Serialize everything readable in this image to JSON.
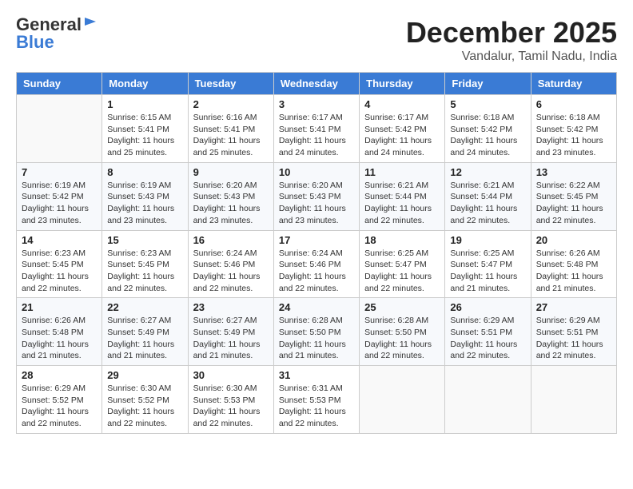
{
  "logo": {
    "general": "General",
    "blue": "Blue"
  },
  "title": {
    "month_year": "December 2025",
    "location": "Vandalur, Tamil Nadu, India"
  },
  "calendar": {
    "headers": [
      "Sunday",
      "Monday",
      "Tuesday",
      "Wednesday",
      "Thursday",
      "Friday",
      "Saturday"
    ],
    "weeks": [
      [
        {
          "day": "",
          "info": ""
        },
        {
          "day": "1",
          "info": "Sunrise: 6:15 AM\nSunset: 5:41 PM\nDaylight: 11 hours\nand 25 minutes."
        },
        {
          "day": "2",
          "info": "Sunrise: 6:16 AM\nSunset: 5:41 PM\nDaylight: 11 hours\nand 25 minutes."
        },
        {
          "day": "3",
          "info": "Sunrise: 6:17 AM\nSunset: 5:41 PM\nDaylight: 11 hours\nand 24 minutes."
        },
        {
          "day": "4",
          "info": "Sunrise: 6:17 AM\nSunset: 5:42 PM\nDaylight: 11 hours\nand 24 minutes."
        },
        {
          "day": "5",
          "info": "Sunrise: 6:18 AM\nSunset: 5:42 PM\nDaylight: 11 hours\nand 24 minutes."
        },
        {
          "day": "6",
          "info": "Sunrise: 6:18 AM\nSunset: 5:42 PM\nDaylight: 11 hours\nand 23 minutes."
        }
      ],
      [
        {
          "day": "7",
          "info": "Sunrise: 6:19 AM\nSunset: 5:42 PM\nDaylight: 11 hours\nand 23 minutes."
        },
        {
          "day": "8",
          "info": "Sunrise: 6:19 AM\nSunset: 5:43 PM\nDaylight: 11 hours\nand 23 minutes."
        },
        {
          "day": "9",
          "info": "Sunrise: 6:20 AM\nSunset: 5:43 PM\nDaylight: 11 hours\nand 23 minutes."
        },
        {
          "day": "10",
          "info": "Sunrise: 6:20 AM\nSunset: 5:43 PM\nDaylight: 11 hours\nand 23 minutes."
        },
        {
          "day": "11",
          "info": "Sunrise: 6:21 AM\nSunset: 5:44 PM\nDaylight: 11 hours\nand 22 minutes."
        },
        {
          "day": "12",
          "info": "Sunrise: 6:21 AM\nSunset: 5:44 PM\nDaylight: 11 hours\nand 22 minutes."
        },
        {
          "day": "13",
          "info": "Sunrise: 6:22 AM\nSunset: 5:45 PM\nDaylight: 11 hours\nand 22 minutes."
        }
      ],
      [
        {
          "day": "14",
          "info": "Sunrise: 6:23 AM\nSunset: 5:45 PM\nDaylight: 11 hours\nand 22 minutes."
        },
        {
          "day": "15",
          "info": "Sunrise: 6:23 AM\nSunset: 5:45 PM\nDaylight: 11 hours\nand 22 minutes."
        },
        {
          "day": "16",
          "info": "Sunrise: 6:24 AM\nSunset: 5:46 PM\nDaylight: 11 hours\nand 22 minutes."
        },
        {
          "day": "17",
          "info": "Sunrise: 6:24 AM\nSunset: 5:46 PM\nDaylight: 11 hours\nand 22 minutes."
        },
        {
          "day": "18",
          "info": "Sunrise: 6:25 AM\nSunset: 5:47 PM\nDaylight: 11 hours\nand 22 minutes."
        },
        {
          "day": "19",
          "info": "Sunrise: 6:25 AM\nSunset: 5:47 PM\nDaylight: 11 hours\nand 21 minutes."
        },
        {
          "day": "20",
          "info": "Sunrise: 6:26 AM\nSunset: 5:48 PM\nDaylight: 11 hours\nand 21 minutes."
        }
      ],
      [
        {
          "day": "21",
          "info": "Sunrise: 6:26 AM\nSunset: 5:48 PM\nDaylight: 11 hours\nand 21 minutes."
        },
        {
          "day": "22",
          "info": "Sunrise: 6:27 AM\nSunset: 5:49 PM\nDaylight: 11 hours\nand 21 minutes."
        },
        {
          "day": "23",
          "info": "Sunrise: 6:27 AM\nSunset: 5:49 PM\nDaylight: 11 hours\nand 21 minutes."
        },
        {
          "day": "24",
          "info": "Sunrise: 6:28 AM\nSunset: 5:50 PM\nDaylight: 11 hours\nand 21 minutes."
        },
        {
          "day": "25",
          "info": "Sunrise: 6:28 AM\nSunset: 5:50 PM\nDaylight: 11 hours\nand 22 minutes."
        },
        {
          "day": "26",
          "info": "Sunrise: 6:29 AM\nSunset: 5:51 PM\nDaylight: 11 hours\nand 22 minutes."
        },
        {
          "day": "27",
          "info": "Sunrise: 6:29 AM\nSunset: 5:51 PM\nDaylight: 11 hours\nand 22 minutes."
        }
      ],
      [
        {
          "day": "28",
          "info": "Sunrise: 6:29 AM\nSunset: 5:52 PM\nDaylight: 11 hours\nand 22 minutes."
        },
        {
          "day": "29",
          "info": "Sunrise: 6:30 AM\nSunset: 5:52 PM\nDaylight: 11 hours\nand 22 minutes."
        },
        {
          "day": "30",
          "info": "Sunrise: 6:30 AM\nSunset: 5:53 PM\nDaylight: 11 hours\nand 22 minutes."
        },
        {
          "day": "31",
          "info": "Sunrise: 6:31 AM\nSunset: 5:53 PM\nDaylight: 11 hours\nand 22 minutes."
        },
        {
          "day": "",
          "info": ""
        },
        {
          "day": "",
          "info": ""
        },
        {
          "day": "",
          "info": ""
        }
      ]
    ]
  }
}
